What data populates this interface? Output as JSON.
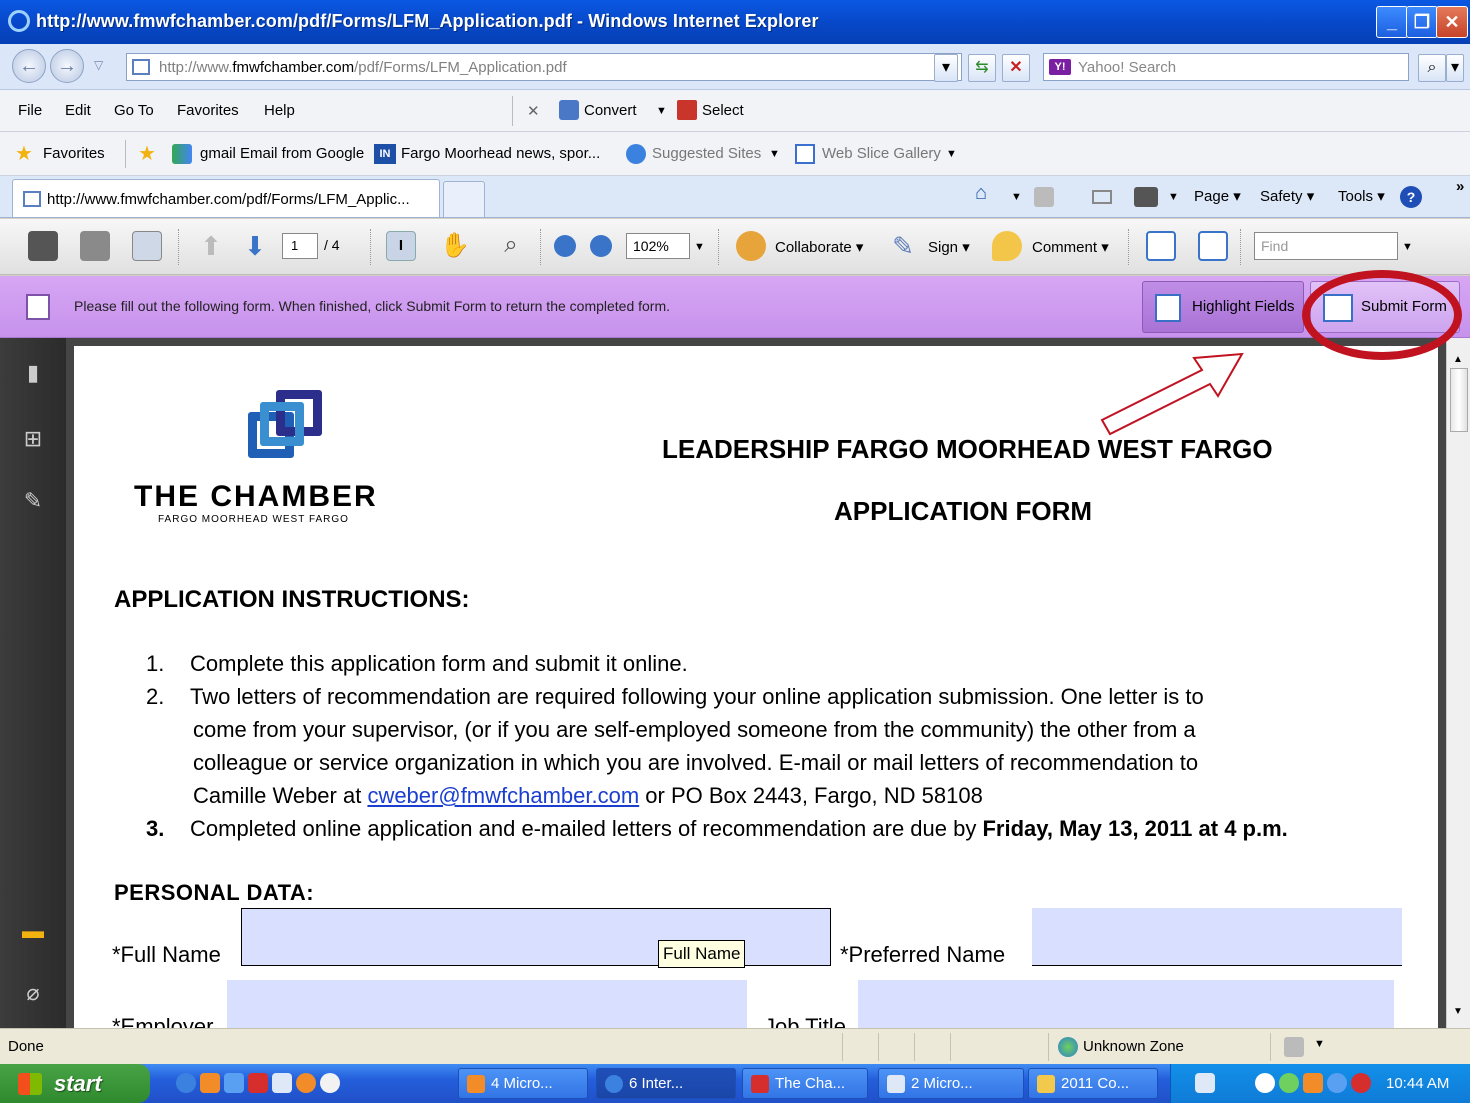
{
  "window": {
    "title": "http://www.fmwfchamber.com/pdf/Forms/LFM_Application.pdf - Windows Internet Explorer"
  },
  "address": {
    "url_prefix": "http://www.",
    "url_domain": "fmwfchamber.com",
    "url_path": "/pdf/Forms/LFM_Application.pdf"
  },
  "search": {
    "placeholder": "Yahoo! Search",
    "badge": "Y!"
  },
  "menu": {
    "file": "File",
    "edit": "Edit",
    "goto": "Go To",
    "favorites": "Favorites",
    "help": "Help",
    "convert": "Convert",
    "select": "Select"
  },
  "favbar": {
    "favorites": "Favorites",
    "items": [
      "gmail Email from Google",
      "Fargo Moorhead news, spor...",
      "Suggested Sites",
      "Web Slice Gallery"
    ]
  },
  "tabs": {
    "active_label": "http://www.fmwfchamber.com/pdf/Forms/LFM_Applic..."
  },
  "commandbar": {
    "page": "Page",
    "safety": "Safety",
    "tools": "Tools"
  },
  "acrobat": {
    "page_current": "1",
    "page_total": "/ 4",
    "zoom": "102%",
    "collaborate": "Collaborate",
    "sign": "Sign",
    "comment": "Comment",
    "find_placeholder": "Find"
  },
  "formbar": {
    "message": "Please fill out the following form. When finished, click Submit Form to return the completed form.",
    "highlight_label": "Highlight Fields",
    "submit_label": "Submit Form"
  },
  "document": {
    "logo_name": "THE CHAMBER",
    "logo_sub": "FARGO MOORHEAD WEST FARGO",
    "title1": "LEADERSHIP FARGO MOORHEAD WEST FARGO",
    "title2": "APPLICATION FORM",
    "instructions_heading": "APPLICATION INSTRUCTIONS:",
    "items": [
      {
        "num": "1.",
        "text": "Complete this application form and submit it online."
      },
      {
        "num": "2.",
        "text": "Two letters of recommendation are required following your online application submission.   One letter is to"
      },
      {
        "num": "3.",
        "text": "Completed online application and e-mailed letters of recommendation are due by ",
        "bold": "Friday, May 13, 2011 at 4 p.m."
      }
    ],
    "item2_cont": [
      "come from your supervisor, (or if you are self-employed someone from the community) the other from a",
      "colleague or service organization in which you are involved.  E-mail or mail letters of recommendation to"
    ],
    "item2_last_pre": "Camille Weber at ",
    "item2_email": "cweber@fmwfchamber.com",
    "item2_last_post": " or PO Box 2443, Fargo, ND  58108",
    "personal_heading": "PERSONAL DATA:",
    "labels": {
      "full_name": "*Full Name",
      "preferred_name": "*Preferred Name",
      "employer": "*Employer",
      "job_title": "Job Title"
    },
    "tooltip": "Full Name"
  },
  "status": {
    "left": "Done",
    "zone": "Unknown Zone"
  },
  "taskbar": {
    "start": "start",
    "tasks": [
      "4 Micro...",
      "6 Inter...",
      "The Cha...",
      "2 Micro...",
      "2011 Co..."
    ],
    "clock": "10:44 AM"
  }
}
